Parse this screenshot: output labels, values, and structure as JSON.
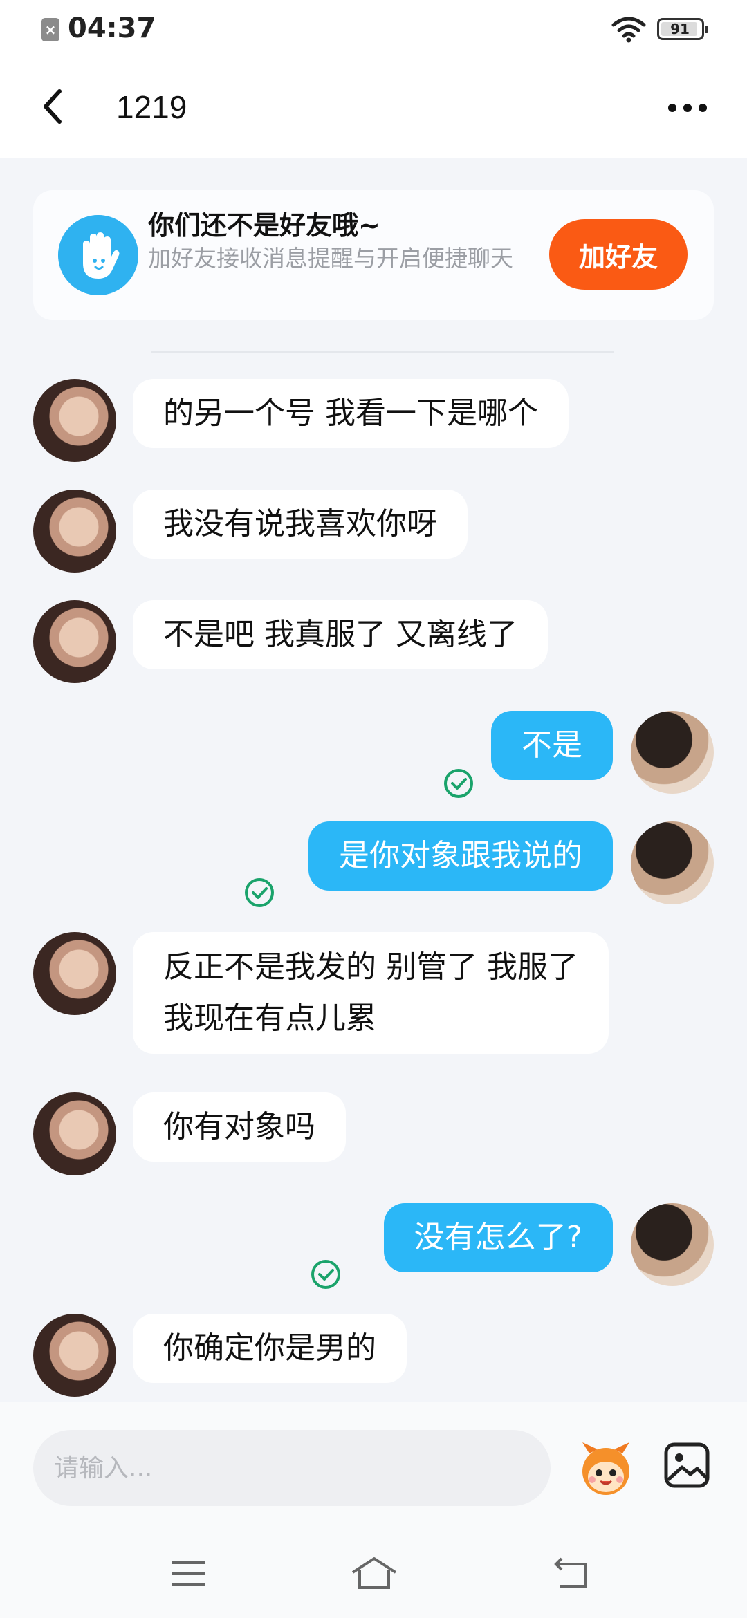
{
  "status_bar": {
    "time": "04:37",
    "battery": "91"
  },
  "header": {
    "title": "1219"
  },
  "friend_banner": {
    "title": "你们还不是好友哦~",
    "subtitle": "加好友接收消息提醒与开启便捷聊天",
    "button": "加好友"
  },
  "messages": [
    {
      "side": "in",
      "text": "的另一个号 我看一下是哪个"
    },
    {
      "side": "in",
      "text": "我没有说我喜欢你呀"
    },
    {
      "side": "in",
      "text": "不是吧 我真服了 又离线了"
    },
    {
      "side": "out",
      "text": "不是"
    },
    {
      "side": "out",
      "text": "是你对象跟我说的"
    },
    {
      "side": "in",
      "text": "反正不是我发的 别管了 我服了",
      "text2": "我现在有点儿累"
    },
    {
      "side": "in",
      "text": "你有对象吗"
    },
    {
      "side": "out",
      "text": "没有怎么了?"
    },
    {
      "side": "in",
      "text": "你确定你是男的"
    }
  ],
  "input": {
    "placeholder": "请输入..."
  },
  "colors": {
    "accent": "#2bb7f7",
    "add_friend": "#fa5a14",
    "read_check": "#1aa36b"
  },
  "icons": [
    "back-icon",
    "more-icon",
    "hand-icon",
    "check-icon",
    "emoji-icon",
    "image-icon",
    "menu-icon",
    "home-icon",
    "return-icon"
  ]
}
